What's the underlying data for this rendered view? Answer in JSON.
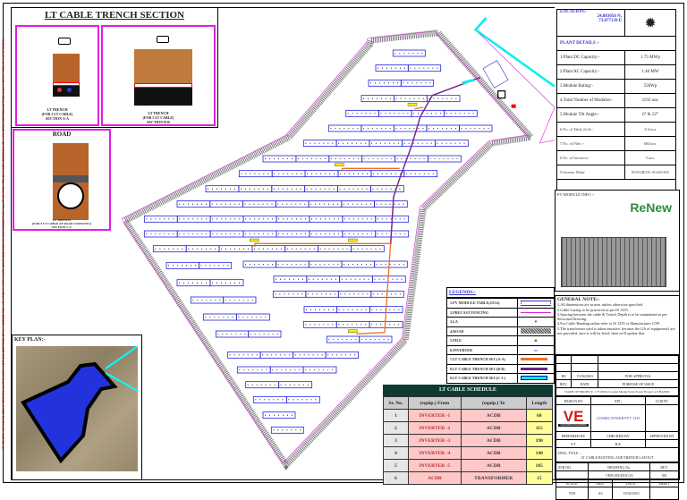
{
  "side_note": "THIS DRAWING IS CONFIDENTIAL IT MUST NOT BE COPIED OR PASSED TO A THIRD PARTY WITHOUT CONSENT. WE RESERVE ALL THE RIGHTS ON NON DESIGN CHARACTERISTICS SPECIALLY FOR PATENT PURPOSES",
  "trench": {
    "title": "LT CABLE  TRENCH SECTION",
    "sec_a": [
      "LT TRENCH",
      "(FOR 2 LT CABLE)",
      "SECTION A-A"
    ],
    "sec_b": [
      "LT TRENCH",
      "(FOR 5 LT CABLE)",
      "SECTION B-B"
    ]
  },
  "road": {
    "title": "ROAD",
    "caption": [
      "LT TRENCH",
      "(FOR 5 LT CABLE AT ROAD CROSSING)",
      "SECTION C-C"
    ]
  },
  "key_plan": {
    "title": "KEY PLAN:-"
  },
  "location": {
    "label": "LOCATION:-",
    "lat": "24.083056 N,",
    "lon": "73.877139 E"
  },
  "plant": {
    "title": "PLANT DETAILS :-",
    "rows": [
      {
        "k": "1.Plant DC Capacity:-",
        "v": "1.75 MWp"
      },
      {
        "k": "2.Plant AC Capacity:-",
        "v": "1.46 MW"
      },
      {
        "k": "3.Module Rating:-",
        "v": "550Wp"
      },
      {
        "k": "4.Total Number of Modules:-",
        "v": "3192 nos."
      },
      {
        "k": "5.Module Tilt Angle:-",
        "v": "6° & 22°"
      },
      {
        "k": "6.No. of Table 2x14:-",
        "v": "114 nos."
      },
      {
        "k": "7.No. of Piles :-",
        "v": "684 nos."
      },
      {
        "k": "8.No. of Inverters:-",
        "v": "5 nos."
      },
      {
        "k": "9.Inverter Make",
        "v": "SUNGROW SG320-HX"
      }
    ]
  },
  "pv_module": {
    "title": "PV MODULE INFO :-",
    "brand": "ReNew"
  },
  "legend": {
    "title": "LEGENDS:-",
    "items": [
      "1.PV MODULE TABLE(2X14)",
      "2.PRECAST FENCING",
      "3.LA",
      "4.ROAD",
      "5.PILE",
      "6.INVERTER",
      "7.LT CABLE TRENCH SEC(A-A)",
      "8.LT CABLE TRENCH SEC(B-B)",
      "9.LT CABLE TRENCH SEC(C-C)"
    ]
  },
  "schedule": {
    "title": "LT CABLE SCHEDULE",
    "headers": [
      "Sr. No.",
      "(equip.) From",
      "(equip.) To",
      "Length"
    ],
    "rows": [
      [
        "1",
        "INVERTER -1",
        "ACDB",
        "60"
      ],
      [
        "2",
        "INVERTER -2",
        "ACDB",
        "115"
      ],
      [
        "3",
        "INVERTER -3",
        "ACDB",
        "190"
      ],
      [
        "4",
        "INVERTER -4",
        "ACDB",
        "140"
      ],
      [
        "5",
        "INVERTER -5",
        "ACDB",
        "185"
      ],
      [
        "6",
        "ACDB",
        "TRANSFORMER",
        "15"
      ]
    ]
  },
  "notes": {
    "title": "GENERAL NOTE:-",
    "items": [
      "1.All dimensions are in mm. unless otherwise specified.",
      "2.Cable Laying to be practiced as per IS 1255.",
      "3.Spacing between the cable & Trench Depth is to be maintained as per Sectional Drawing.",
      "4.For Cable Bending radius refer to IS 1255 or Manufacturer GTP.",
      "5.The transformer yard is taken tentative, because the GA of equipment's are not provided, once it will be fixed, then we'll update that."
    ]
  },
  "title_block": {
    "rev_row": [
      "R0",
      "15/04/2023",
      "FOR APPROVAL"
    ],
    "rev_head": [
      "REV.",
      "DATE",
      "PURPOSE OF ISSUE"
    ],
    "project": "NAME OF PROJECT: 1.75 MWp Ground Mount Solar Power Project at CHAPUR",
    "design_by": "DESIGN BY",
    "epc": "EPC",
    "client": "CLIENT",
    "epc_name": "COSMIC POWER PVT. LTD",
    "logo_text": "VE",
    "logo_sub": "VASUDHA ENGINEERS",
    "prepared_by": "PREPARED BY",
    "checked_by": "CHECKED BY",
    "approved_by": "APPROVED BY",
    "prepared": "S.T",
    "checked": "B.K",
    "dwg_title_label": "DWG. TITLE :",
    "dwg_title": "LT CABLE ROUTING AND TRENCH LAYOUT",
    "job_no": "JOB NO.",
    "drawing_no_label": "DRAWING No.",
    "drawing_no": "VEPL/EE/DOC/23",
    "rev_label": "REV.",
    "rev": "R0",
    "scale_label": "SCALE:",
    "size_label": "SIZE:",
    "date_label": "DATE:",
    "sheet_label": "SHEET",
    "scale": "NTS",
    "size": "A3",
    "date": "15/04/2023"
  }
}
